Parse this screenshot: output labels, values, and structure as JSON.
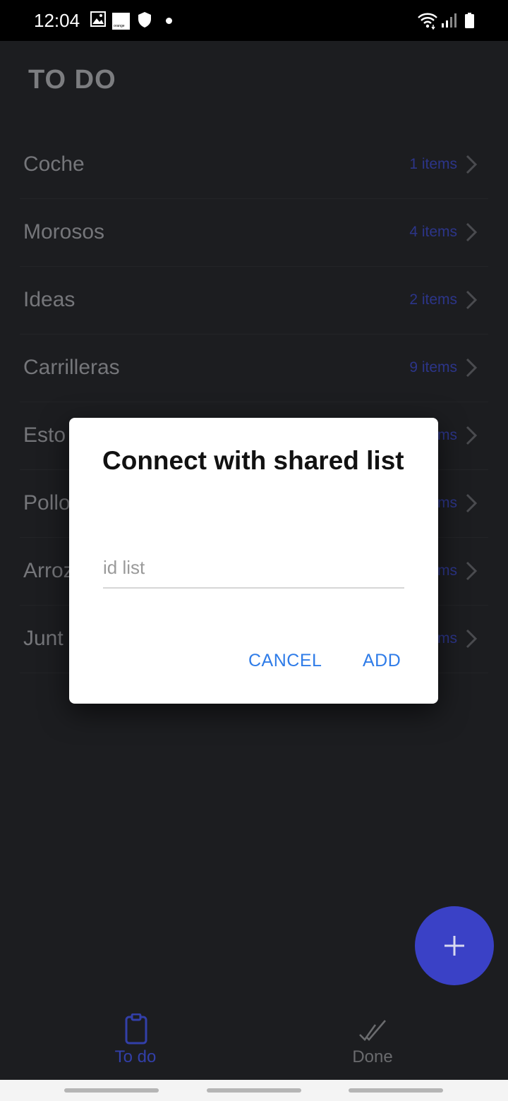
{
  "status_bar": {
    "time": "12:04",
    "orange_logo_text": "orange",
    "icons": [
      "gallery-icon",
      "orange-logo-icon",
      "shield-icon",
      "notification-dot-icon",
      "wifi-icon",
      "signal-icon",
      "battery-icon"
    ]
  },
  "app": {
    "title": "TO DO"
  },
  "lists": [
    {
      "name": "Coche",
      "count": "1 items"
    },
    {
      "name": "Morosos",
      "count": "4 items"
    },
    {
      "name": "Ideas",
      "count": "2 items"
    },
    {
      "name": "Carrilleras",
      "count": "9 items"
    },
    {
      "name": "Esto",
      "count": "ms"
    },
    {
      "name": "Pollo",
      "count": "ms"
    },
    {
      "name": "Arroz",
      "count": "ms"
    },
    {
      "name": "Junt",
      "count": "ms"
    }
  ],
  "dialog": {
    "title": "Connect with shared list",
    "input_placeholder": "id list",
    "input_value": "",
    "cancel_label": "CANCEL",
    "add_label": "ADD"
  },
  "fab": {
    "icon": "plus-icon"
  },
  "bottom_nav": {
    "todo_label": "To do",
    "done_label": "Done",
    "selected": "To do"
  },
  "colors": {
    "accent": "#3a41c6",
    "dialog_button": "#2f7ce8",
    "background": "#1c1d20"
  }
}
